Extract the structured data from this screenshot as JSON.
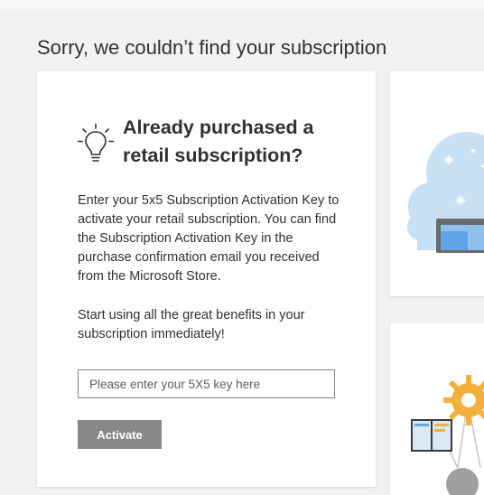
{
  "page": {
    "title": "Sorry, we couldn’t find your subscription"
  },
  "retail_card": {
    "icon": "lightbulb-icon",
    "heading": "Already purchased a retail subscription?",
    "description": "Enter your 5x5 Subscription Activation Key to activate your retail subscription. You can find the Subscription Activation Key in the purchase confirmation email you received from the Microsoft Store.",
    "benefits": "Start using all the great benefits in your subscription immediately!",
    "key_input": {
      "placeholder": "Please enter your 5X5 key here",
      "value": ""
    },
    "activate_label": "Activate"
  },
  "side_cards": {
    "top_illustration": "cloud-laptop-illustration",
    "bottom_illustration": "gear-book-illustration"
  },
  "colors": {
    "background": "#f3f2f1",
    "button_disabled": "#8a8886",
    "illustration_blue": "#c7e0f4",
    "illustration_orange": "#f4b03e"
  }
}
